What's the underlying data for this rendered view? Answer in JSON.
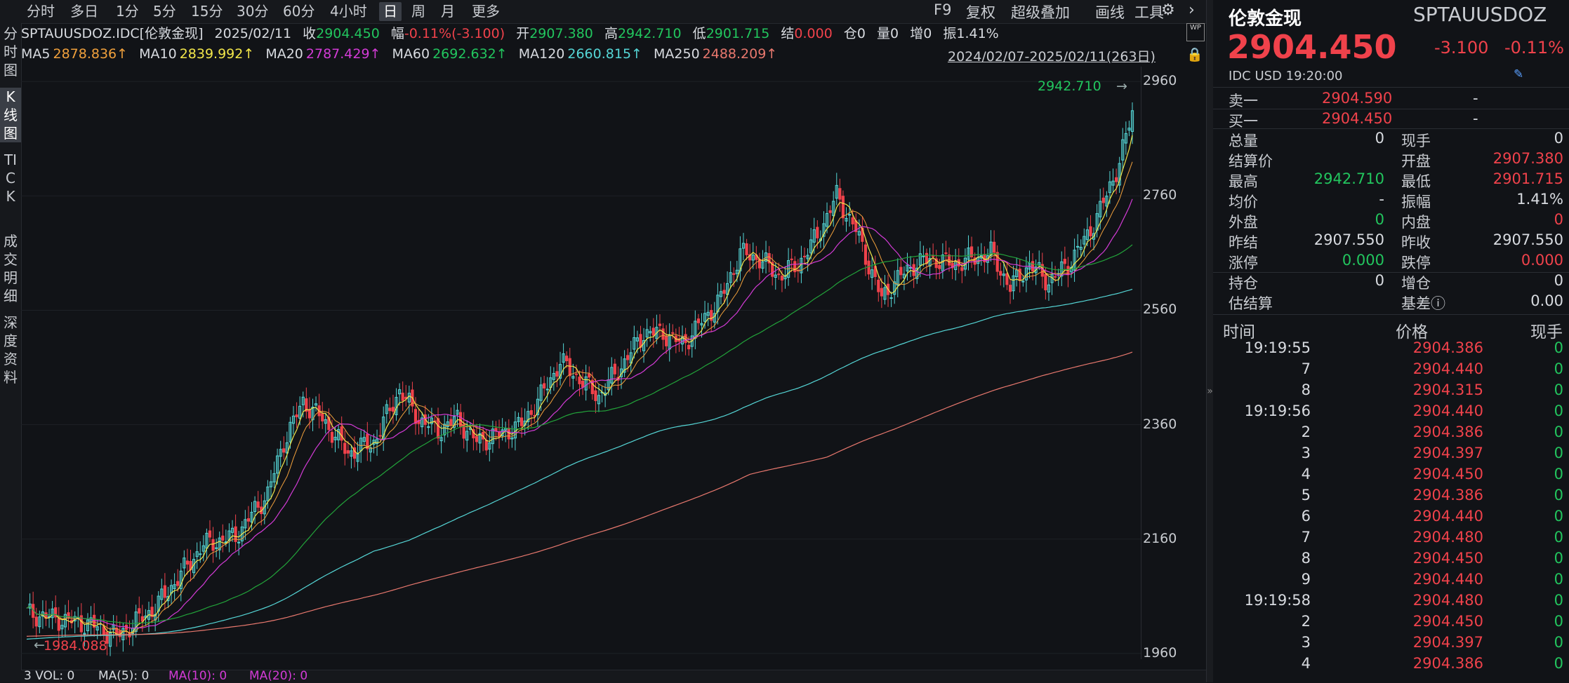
{
  "toolbar": {
    "periods": [
      "分时",
      "多日",
      "1分",
      "5分",
      "15分",
      "30分",
      "60分",
      "4小时",
      "日",
      "周",
      "月",
      "更多"
    ],
    "active_period": "日",
    "right_items": [
      "F9",
      "复权",
      "超级叠加",
      "画线",
      "工具"
    ]
  },
  "left_tabs": [
    "分时图",
    "K线图",
    "TICK",
    "成交明细",
    "深度资料"
  ],
  "info": {
    "symbol": "SPTAUUSDOZ.IDC[伦敦金现]",
    "date": "2025/02/11",
    "close_label": "收",
    "close": "2904.450",
    "amp_label": "幅",
    "change": "-0.11%(-3.100)",
    "open_label": "开",
    "open": "2907.380",
    "high_label": "高",
    "high": "2942.710",
    "low_label": "低",
    "low": "2901.715",
    "settle_label": "结",
    "settle": "0.000",
    "oi_label": "仓",
    "oi": "0",
    "vol_label": "量",
    "vol": "0",
    "inc_label": "增",
    "inc": "0",
    "range_label": "振",
    "range": "1.41%"
  },
  "ma": {
    "ma5_label": "MA5",
    "ma5": "2878.836↑",
    "ma10_label": "MA10",
    "ma10": "2839.992↑",
    "ma20_label": "MA20",
    "ma20": "2787.429↑",
    "ma60_label": "MA60",
    "ma60": "2692.632↑",
    "ma120_label": "MA120",
    "ma120": "2660.815↑",
    "ma250_label": "MA250",
    "ma250": "2488.209↑",
    "period": "2024/02/07-2025/02/11(263日)"
  },
  "chart": {
    "y_ticks": [
      "2960",
      "2760",
      "2560",
      "2360",
      "2160",
      "1960"
    ],
    "max_label": "2942.710",
    "min_label": "1984.088"
  },
  "volume": {
    "text": "3 VOL: 0",
    "ma5": "MA(5): 0",
    "ma10": "MA(10): 0",
    "ma20": "MA(20): 0"
  },
  "right": {
    "name": "伦敦金现",
    "code": "SPTAUUSDOZ",
    "price": "2904.450",
    "change": "-3.100",
    "change_pct": "-0.11%",
    "source": "IDC  USD  19:20:00",
    "sell_label": "卖一",
    "sell_price": "2904.590",
    "sell_vol": "-",
    "buy_label": "买一",
    "buy_price": "2904.450",
    "buy_vol": "-",
    "stats": [
      {
        "l1": "总量",
        "v1": "0",
        "c1": "w",
        "l2": "现手",
        "v2": "0",
        "c2": "w"
      },
      {
        "l1": "结算价",
        "v1": "",
        "c1": "w",
        "l2": "开盘",
        "v2": "2907.380",
        "c2": "r"
      },
      {
        "l1": "最高",
        "v1": "2942.710",
        "c1": "g",
        "l2": "最低",
        "v2": "2901.715",
        "c2": "r"
      },
      {
        "l1": "均价",
        "v1": "-",
        "c1": "w",
        "l2": "振幅",
        "v2": "1.41%",
        "c2": "w"
      },
      {
        "l1": "外盘",
        "v1": "0",
        "c1": "g",
        "l2": "内盘",
        "v2": "0",
        "c2": "r"
      },
      {
        "l1": "昨结",
        "v1": "2907.550",
        "c1": "w",
        "l2": "昨收",
        "v2": "2907.550",
        "c2": "w"
      },
      {
        "l1": "涨停",
        "v1": "0.000",
        "c1": "g",
        "l2": "跌停",
        "v2": "0.000",
        "c2": "r"
      }
    ],
    "stats2": [
      {
        "l1": "持仓",
        "v1": "0",
        "c1": "w",
        "l2": "增仓",
        "v2": "0",
        "c2": "w"
      },
      {
        "l1": "估结算",
        "v1": "",
        "c1": "w",
        "l2": "基差ⓘ",
        "v2": "0.00",
        "c2": "w"
      }
    ],
    "ticks_header": {
      "time": "时间",
      "price": "价格",
      "vol": "现手"
    },
    "ticks": [
      {
        "t": "19:19:55",
        "p": "2904.386",
        "v": "0"
      },
      {
        "t": "7",
        "p": "2904.440",
        "v": "0"
      },
      {
        "t": "8",
        "p": "2904.315",
        "v": "0"
      },
      {
        "t": "19:19:56",
        "p": "2904.440",
        "v": "0"
      },
      {
        "t": "2",
        "p": "2904.386",
        "v": "0"
      },
      {
        "t": "3",
        "p": "2904.397",
        "v": "0"
      },
      {
        "t": "4",
        "p": "2904.450",
        "v": "0"
      },
      {
        "t": "5",
        "p": "2904.386",
        "v": "0"
      },
      {
        "t": "6",
        "p": "2904.440",
        "v": "0"
      },
      {
        "t": "7",
        "p": "2904.480",
        "v": "0"
      },
      {
        "t": "8",
        "p": "2904.450",
        "v": "0"
      },
      {
        "t": "9",
        "p": "2904.440",
        "v": "0"
      },
      {
        "t": "19:19:58",
        "p": "2904.480",
        "v": "0"
      },
      {
        "t": "2",
        "p": "2904.450",
        "v": "0"
      },
      {
        "t": "3",
        "p": "2904.397",
        "v": "0"
      },
      {
        "t": "4",
        "p": "2904.386",
        "v": "0"
      }
    ]
  }
}
